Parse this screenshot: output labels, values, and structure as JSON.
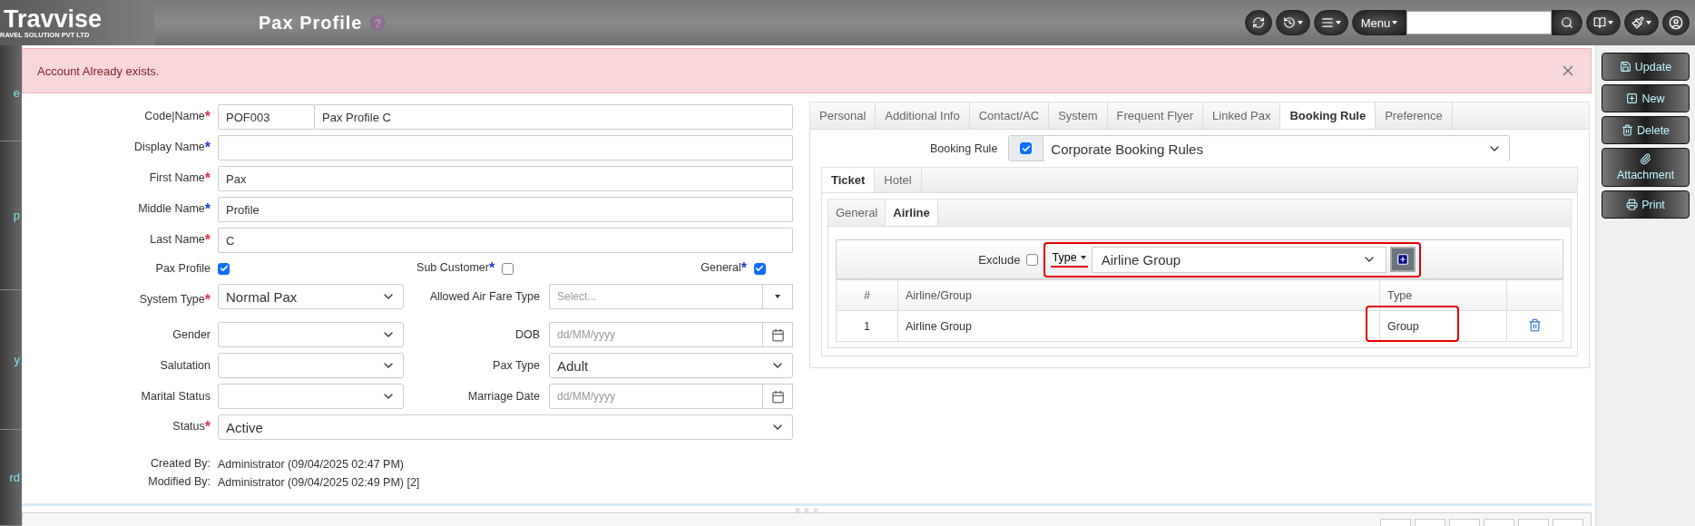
{
  "header": {
    "logo": {
      "name": "Travvise",
      "tagline": "RAVEL SOLUTION PVT LTD"
    },
    "title": "Pax Profile",
    "help": "?",
    "tools": [
      {
        "kind": "refresh",
        "caret": false
      },
      {
        "kind": "history",
        "caret": true
      },
      {
        "kind": "list",
        "caret": true
      }
    ],
    "menu_button": "Menu",
    "extra_tools": [
      {
        "kind": "book",
        "caret": true
      },
      {
        "kind": "brush",
        "caret": true
      },
      {
        "kind": "user",
        "caret": false
      }
    ]
  },
  "side_nav": [
    "e",
    "p",
    "y",
    "rd"
  ],
  "alert": {
    "message": "Account Already exists."
  },
  "form": {
    "code_name": {
      "label": "Code|Name",
      "star": "*",
      "color": "#dc3545",
      "code": "POF003",
      "name": "Pax Profile C"
    },
    "text_fields": [
      {
        "label": "Display Name",
        "star": "*",
        "color": "#1a3fd1"
      },
      {
        "label": "First Name",
        "star": "*",
        "color": "#dc3545",
        "value": "Pax"
      },
      {
        "label": "Middle Name",
        "star": "*",
        "color": "#1a3fd1",
        "value": "Profile"
      },
      {
        "label": "Last Name",
        "star": "*",
        "color": "#dc3545",
        "value": "C"
      }
    ],
    "checks": [
      {
        "label": "Pax Profile",
        "checked": true
      },
      {
        "label": "Sub Customer",
        "star": "*",
        "color": "#1a3fd1",
        "checked": false
      },
      {
        "label": "General",
        "star": "*",
        "color": "#1a3fd1",
        "checked": true
      }
    ],
    "pairs": [
      {
        "left": {
          "label": "System Type",
          "star": "*",
          "color": "#dc3545",
          "kind": "select",
          "value": "Normal Pax"
        },
        "right": {
          "label": "Allowed Air Fare Type",
          "kind": "picker",
          "placeholder": "Select..."
        }
      },
      {
        "left": {
          "label": "Gender",
          "kind": "select"
        },
        "right": {
          "label": "DOB",
          "kind": "date",
          "placeholder": "dd/MM/yyyy"
        }
      },
      {
        "left": {
          "label": "Salutation",
          "kind": "select"
        },
        "right": {
          "label": "Pax Type",
          "kind": "select",
          "value": "Adult"
        }
      },
      {
        "left": {
          "label": "Marital Status",
          "kind": "select"
        },
        "right": {
          "label": "Marriage Date",
          "kind": "date",
          "placeholder": "dd/MM/yyyy"
        }
      }
    ],
    "status": {
      "label": "Status",
      "star": "*",
      "color": "#dc3545",
      "value": "Active"
    },
    "audit": [
      {
        "label": "Created By:",
        "value": "Administrator (09/04/2025 02:47 PM)"
      },
      {
        "label": "Modified By:",
        "value": "Administrator (09/04/2025 02:49 PM) [2]"
      }
    ]
  },
  "details": {
    "tabs": [
      {
        "label": "Personal",
        "selected": false
      },
      {
        "label": "Additional Info",
        "selected": false
      },
      {
        "label": "Contact/AC",
        "selected": false
      },
      {
        "label": "System",
        "selected": false
      },
      {
        "label": "Frequent Flyer",
        "selected": false
      },
      {
        "label": "Linked Pax",
        "selected": false
      },
      {
        "label": "Booking Rule",
        "selected": true
      },
      {
        "label": "Preference",
        "selected": false
      }
    ],
    "booking_rule": {
      "label": "Booking Rule",
      "checked": true,
      "value": "Corporate Booking Rules"
    },
    "sub_tabs": [
      {
        "label": "Ticket",
        "selected": true
      },
      {
        "label": "Hotel",
        "selected": false
      }
    ],
    "inner_tabs": [
      {
        "label": "General",
        "selected": false
      },
      {
        "label": "Airline",
        "selected": true
      }
    ],
    "filter": {
      "exclude_label": "Exclude",
      "exclude_checked": false,
      "type_label": "Type",
      "value": "Airline Group"
    },
    "table": {
      "columns": [
        "#",
        "Airline/Group",
        "Type"
      ],
      "rows": [
        {
          "cells": [
            "1",
            "Airline Group",
            "Group"
          ]
        }
      ]
    }
  },
  "actions": [
    {
      "kind": "save",
      "label": "Update"
    },
    {
      "kind": "new",
      "label": "New"
    },
    {
      "kind": "delete",
      "label": "Delete"
    },
    {
      "kind": "attach",
      "label": "Attachment"
    },
    {
      "kind": "print",
      "label": "Print"
    }
  ]
}
